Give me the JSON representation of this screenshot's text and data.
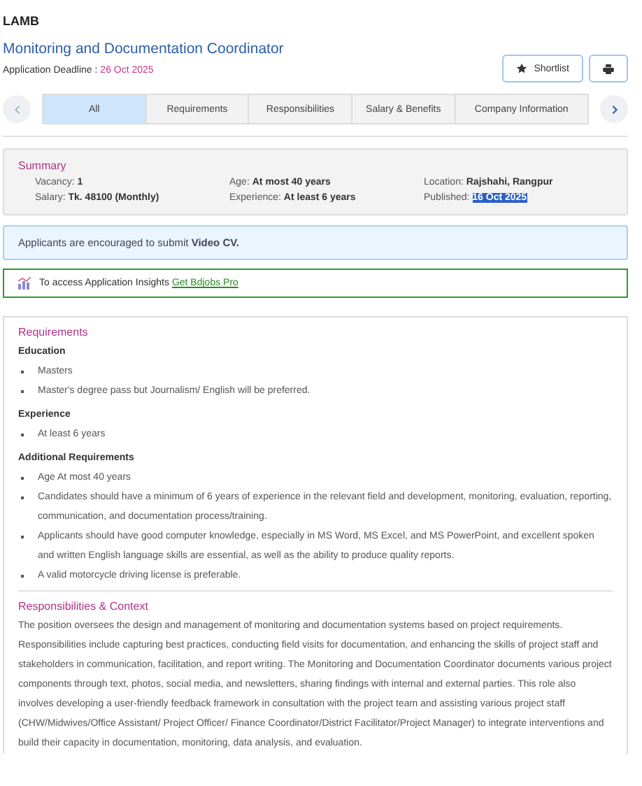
{
  "company": "LAMB",
  "job_title": "Monitoring and Documentation Coordinator",
  "deadline": {
    "label": "Application Deadline :",
    "value": "26 Oct 2025"
  },
  "actions": {
    "shortlist": "Shortlist"
  },
  "tabs": [
    {
      "label": "All",
      "selected": true
    },
    {
      "label": "Requirements",
      "selected": false
    },
    {
      "label": "Responsibilities",
      "selected": false
    },
    {
      "label": "Salary & Benefits",
      "selected": false
    },
    {
      "label": "Company Information",
      "selected": false
    }
  ],
  "summary": {
    "title": "Summary",
    "items": [
      {
        "label": "Vacancy:",
        "value": "1",
        "highlighted": false
      },
      {
        "label": "Age:",
        "value": "At most 40 years",
        "highlighted": false
      },
      {
        "label": "Location:",
        "value": "Rajshahi, Rangpur",
        "highlighted": false
      },
      {
        "label": "Salary:",
        "value": "Tk. 48100 (Monthly)",
        "highlighted": false
      },
      {
        "label": "Experience:",
        "value": "At least 6 years",
        "highlighted": false
      },
      {
        "label": "Published:",
        "value": "16 Oct 2025",
        "highlighted": true
      }
    ]
  },
  "video_notice": "Applicants are encouraged to submit **Video CV.**",
  "insights": {
    "text": "To access Application Insights",
    "link": "Get Bdjobs Pro"
  },
  "requirements": {
    "title": "Requirements",
    "groups": [
      {
        "heading": "Education",
        "items": [
          "Masters",
          "Master's degree pass but Journalism/ English will be preferred."
        ]
      },
      {
        "heading": "Experience",
        "items": [
          "At least 6 years"
        ]
      },
      {
        "heading": "Additional Requirements",
        "items": [
          "Age At most 40 years",
          "Candidates should have a minimum of 6 years of experience in the relevant field and development, monitoring, evaluation, reporting, communication, and documentation process/training.",
          "Applicants should have good computer knowledge, especially in MS Word, MS Excel, and MS PowerPoint, and excellent spoken and written English language skills are essential, as well as the ability to produce quality reports.",
          "A valid motorcycle driving license is preferable."
        ]
      }
    ]
  },
  "responsibilities": {
    "title": "Responsibilities & Context",
    "text": "The position oversees the design and management of monitoring and documentation systems based on project requirements. Responsibilities include capturing best practices, conducting field visits for documentation, and enhancing the skills of project staff and stakeholders in communication, facilitation, and report writing. The Monitoring and Documentation Coordinator documents various project components through text, photos, social media, and newsletters, sharing findings with internal and external parties. This role also involves developing a user-friendly feedback framework in consultation with the project team and assisting various project staff (CHW/Midwives/Office Assistant/ Project Officer/ Finance Coordinator/District Facilitator/Project Manager) to integrate interventions and build their capacity in documentation, monitoring, data analysis, and evaluation."
  }
}
